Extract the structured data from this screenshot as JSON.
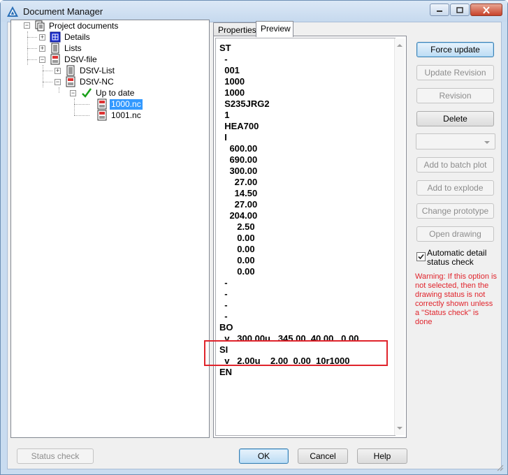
{
  "window": {
    "title": "Document Manager",
    "icons": {
      "app": "autocad-icon",
      "minimize": "minimize-icon",
      "maximize": "maximize-icon",
      "close": "close-icon"
    }
  },
  "tree": {
    "root": {
      "label": "Project documents",
      "icon": "documents-icon",
      "expanded": true
    },
    "items": [
      {
        "label": "Details",
        "icon": "details-icon",
        "expanded": false
      },
      {
        "label": "Lists",
        "icon": "lists-icon",
        "expanded": false
      },
      {
        "label": "DStV-file",
        "icon": "dstv-file-icon",
        "expanded": true
      },
      {
        "label": "DStV-List",
        "icon": "dstv-list-icon",
        "expanded": false
      },
      {
        "label": "DStV-NC",
        "icon": "dstv-nc-icon",
        "expanded": true
      },
      {
        "label": "Up to date",
        "icon": "checkmark-icon",
        "expanded": true
      },
      {
        "label": "1000.nc",
        "icon": "nc-file-icon",
        "selected": true
      },
      {
        "label": "1001.nc",
        "icon": "nc-file-icon",
        "selected": false
      }
    ]
  },
  "tabs": [
    {
      "label": "Properties",
      "active": false
    },
    {
      "label": "Preview",
      "active": true
    }
  ],
  "preview": {
    "lines": [
      "ST",
      "  -",
      "  001",
      "  1000",
      "  1000",
      "  S235JRG2",
      "  1",
      "  HEA700",
      "  I",
      "    600.00",
      "    690.00",
      "    300.00",
      "      27.00",
      "      14.50",
      "      27.00",
      "    204.00",
      "       2.50",
      "       0.00",
      "       0.00",
      "       0.00",
      "       0.00",
      "  -",
      "  -",
      "  -",
      "  -",
      "BO",
      "  v   300.00u   345.00  40.00   0.00",
      "SI",
      "  v   2.00u    2.00  0.00  10r1000",
      "EN"
    ]
  },
  "buttons": {
    "force_update": "Force update",
    "update_revision": "Update Revision",
    "revision": "Revision",
    "delete": "Delete",
    "add_to_batch_plot": "Add to batch plot",
    "add_to_explode": "Add to explode",
    "change_prototype": "Change prototype",
    "open_drawing": "Open drawing",
    "status_check": "Status check",
    "ok": "OK",
    "cancel": "Cancel",
    "help": "Help"
  },
  "combo": {
    "value": ""
  },
  "auto_check": {
    "label": "Automatic detail status check",
    "checked": true
  },
  "warning": "Warning: If this option is not selected, then the drawing status is not correctly shown unless a \"Status check\" is done",
  "colors": {
    "warning": "#e0242c",
    "highlight_box": "#e0242c",
    "selection": "#3399ff"
  }
}
